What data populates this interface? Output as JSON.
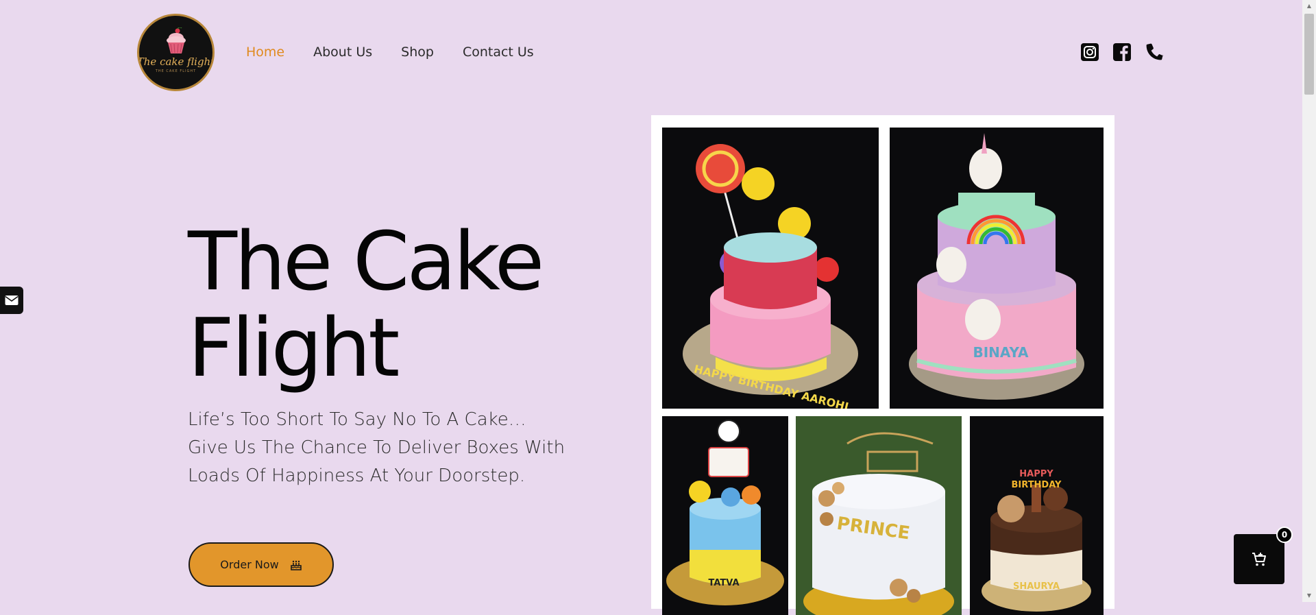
{
  "brand": {
    "logo_text": "The cake flight",
    "logo_subtext": "THE CAKE FLIGHT"
  },
  "nav": {
    "items": [
      {
        "label": "Home",
        "active": true
      },
      {
        "label": "About Us",
        "active": false
      },
      {
        "label": "Shop",
        "active": false
      },
      {
        "label": "Contact Us",
        "active": false
      }
    ]
  },
  "socials": [
    "instagram-icon",
    "facebook-icon",
    "phone-icon"
  ],
  "hero": {
    "title_line1": "The Cake",
    "title_line2": "Flight",
    "subtitle_line1": "Life’s Too Short To Say No To A Cake…",
    "subtitle_line2": "Give Us The Chance To Deliver Boxes With",
    "subtitle_line3": "Loads Of Happiness At Your Doorstep.",
    "cta_label": "Order Now"
  },
  "cake_names": [
    "HAPPY BIRTHDAY AAROHI",
    "BINAYA",
    "TATVA",
    "PRINCE",
    "SHAURYA"
  ],
  "cart": {
    "count": "0"
  },
  "colors": {
    "background": "#e9d9ee",
    "accent": "#e2962b",
    "nav_active": "#e08a1e"
  }
}
